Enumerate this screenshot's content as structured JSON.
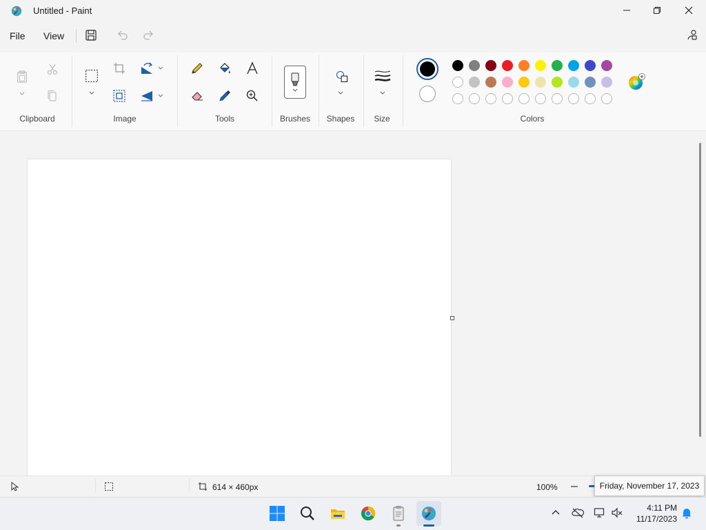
{
  "window": {
    "title": "Untitled - Paint",
    "icon": "paint-palette-icon"
  },
  "menu": {
    "file": "File",
    "view": "View"
  },
  "ribbon": {
    "groups": {
      "clipboard": "Clipboard",
      "image": "Image",
      "tools": "Tools",
      "brushes": "Brushes",
      "shapes": "Shapes",
      "size": "Size",
      "colors": "Colors"
    },
    "colors": {
      "primary": "#000000",
      "secondary": "#ffffff",
      "row1": [
        "#000000",
        "#7f7f7f",
        "#880015",
        "#ed1c24",
        "#ff7f27",
        "#fff200",
        "#22b14c",
        "#00a2e8",
        "#3f48cc",
        "#a349a4"
      ],
      "row2": [
        "#ffffff",
        "#c3c3c3",
        "#b97a57",
        "#ffaec9",
        "#ffc90e",
        "#efe4b0",
        "#b5e61d",
        "#99d9ea",
        "#7092be",
        "#c8bfe7"
      ],
      "row3_empty_count": 10
    }
  },
  "status": {
    "canvas_size": "614 × 460px",
    "zoom": "100%"
  },
  "tooltip": {
    "date_full": "Friday, November 17, 2023"
  },
  "taskbar": {
    "apps": [
      "start-icon",
      "search-icon",
      "file-explorer-icon",
      "chrome-icon",
      "notepad-icon",
      "paint-icon"
    ],
    "time": "4:11 PM",
    "date": "11/17/2023"
  }
}
